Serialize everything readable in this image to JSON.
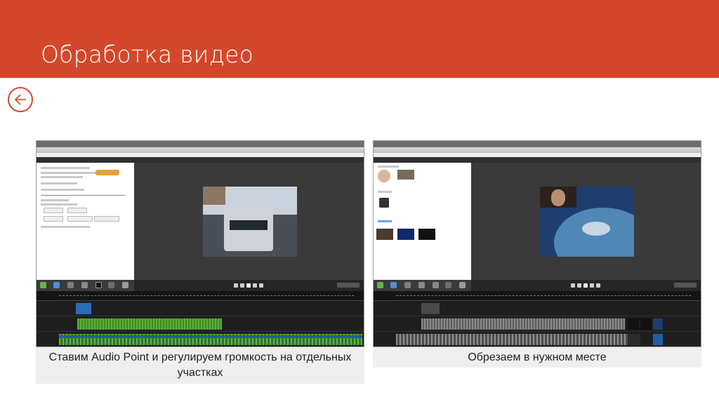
{
  "slide": {
    "title": "Обработка видео",
    "accent_color": "#d4472b"
  },
  "back_button": {
    "icon": "arrow-left-icon"
  },
  "screenshots": [
    {
      "caption": "Ставим Audio Point и регулируем громкость на отдельных участках"
    },
    {
      "caption": "Обрезаем в нужном месте"
    }
  ]
}
